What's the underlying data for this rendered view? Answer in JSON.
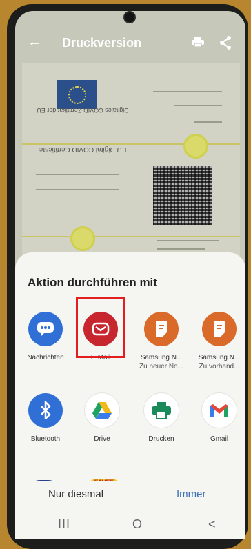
{
  "appbar": {
    "title": "Druckversion",
    "back_icon": "arrow-left-icon",
    "print_icon": "printer-icon",
    "share_icon": "share-icon"
  },
  "certificate": {
    "title": "EU Digital COVID Certificate",
    "subtitle": "Digitales COVID-Zertifikat der EU"
  },
  "sheet": {
    "heading": "Aktion durchführen mit",
    "apps": [
      {
        "label": "Nachrichten",
        "sub": "",
        "icon": "messages-icon",
        "color": "#2f6fd6"
      },
      {
        "label": "E-Mail",
        "sub": "",
        "icon": "email-icon",
        "color": "#c8262f"
      },
      {
        "label": "Samsung N...",
        "sub": "Zu neuer No...",
        "icon": "samsung-notes-icon",
        "color": "#d96a2a"
      },
      {
        "label": "Samsung N...",
        "sub": "Zu vorhand...",
        "icon": "samsung-notes-icon",
        "color": "#d96a2a"
      },
      {
        "label": "Bluetooth",
        "sub": "",
        "icon": "bluetooth-icon",
        "color": "#2f6fd6"
      },
      {
        "label": "Drive",
        "sub": "",
        "icon": "drive-icon",
        "color": "#ffffff"
      },
      {
        "label": "Drucken",
        "sub": "",
        "icon": "print-icon",
        "color": "#ffffff"
      },
      {
        "label": "Gmail",
        "sub": "",
        "icon": "gmail-icon",
        "color": "#ffffff"
      }
    ],
    "buttons": {
      "once": "Nur diesmal",
      "always": "Immer"
    }
  },
  "navbar": {
    "recent": "III",
    "home": "O",
    "back": "<"
  }
}
